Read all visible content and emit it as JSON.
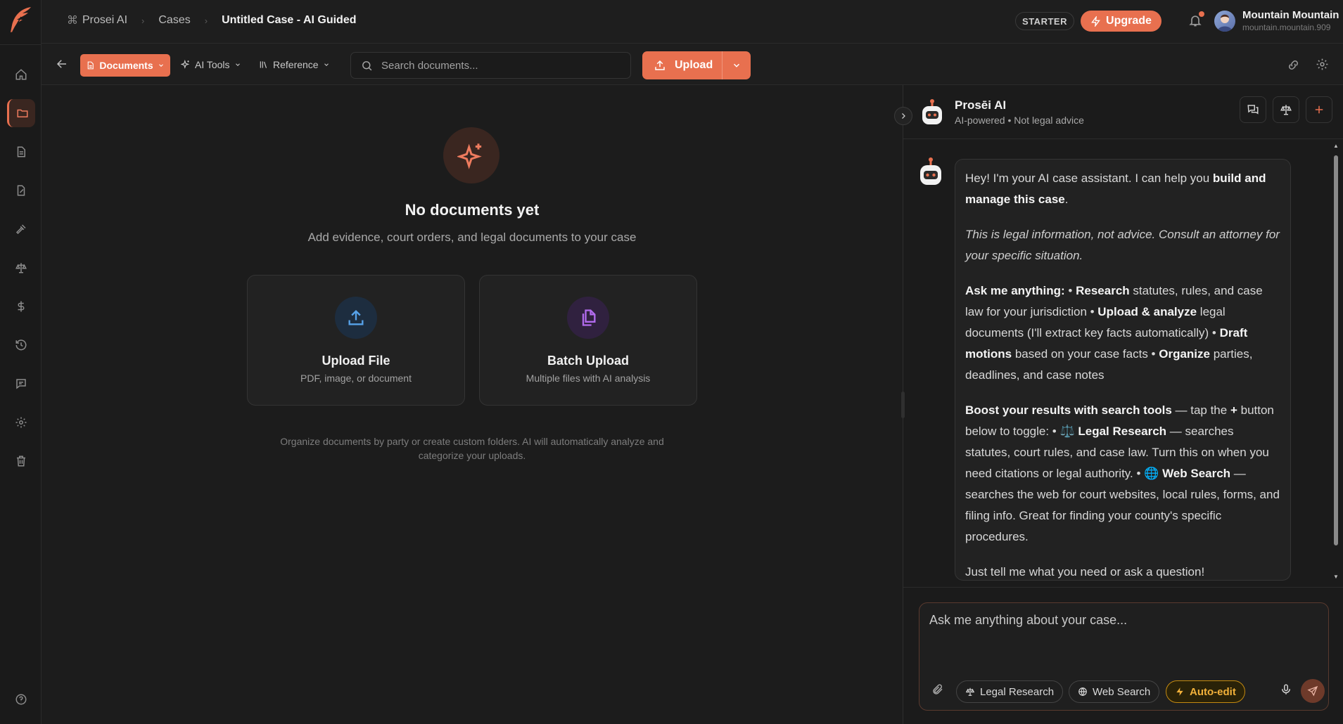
{
  "topbar": {
    "breadcrumbs": [
      "Prosei AI",
      "Cases",
      "Untitled Case - AI Guided"
    ],
    "plan_badge": "STARTER",
    "upgrade_label": "Upgrade",
    "user": {
      "name": "Mountain Mountain",
      "email": "mountain.mountain.909"
    }
  },
  "toolbar": {
    "documents_label": "Documents",
    "ai_tools_label": "AI Tools",
    "reference_label": "Reference",
    "search_placeholder": "Search documents...",
    "upload_label": "Upload"
  },
  "main": {
    "empty_title": "No documents yet",
    "empty_subtitle": "Add evidence, court orders, and legal documents to your case",
    "cards": [
      {
        "title": "Upload File",
        "subtitle": "PDF, image, or document"
      },
      {
        "title": "Batch Upload",
        "subtitle": "Multiple files with AI analysis"
      }
    ],
    "hint": "Organize documents by party or create custom folders. AI will automatically analyze and categorize your uploads."
  },
  "assistant": {
    "name": "Prosēi AI",
    "subtitle": "AI-powered • Not legal advice",
    "message": {
      "p1_a": "Hey! I'm your AI case assistant. I can help you ",
      "p1_b": "build and manage this case",
      "p1_c": ".",
      "p2": "This is legal information, not advice. Consult an attorney for your specific situation.",
      "p3": [
        {
          "b": "Ask me anything:",
          "t": " • "
        },
        {
          "b": "Research",
          "t": " statutes, rules, and case law for your jurisdiction • "
        },
        {
          "b": "Upload & analyze",
          "t": " legal documents (I'll extract key facts automatically) • "
        },
        {
          "b": "Draft motions",
          "t": " based on your case facts • "
        },
        {
          "b": "Organize",
          "t": " parties, deadlines, and case notes"
        }
      ],
      "p4": [
        {
          "b": "Boost your results with search tools",
          "t": " — tap the "
        },
        {
          "b": "+",
          "t": " button below to toggle: • ⚖️ "
        },
        {
          "b": "Legal Research",
          "t": " — searches statutes, court rules, and case law. Turn this on when you need citations or legal authority. • 🌐 "
        },
        {
          "b": "Web Search",
          "t": " — searches the web for court websites, local rules, forms, and filing info. Great for finding your county's specific procedures."
        }
      ],
      "p5": "Just tell me what you need or ask a question!"
    },
    "input_placeholder": "Ask me anything about your case...",
    "chips": {
      "legal_research": "Legal Research",
      "web_search": "Web Search",
      "auto_edit": "Auto-edit"
    }
  },
  "colors": {
    "accent": "#e8704f",
    "background": "#1c1c1c",
    "auto_edit": "#f2b13a"
  },
  "icons": {
    "rail": [
      "home-icon",
      "folder-icon",
      "document-icon",
      "edit-document-icon",
      "gavel-icon",
      "scales-icon",
      "dollar-icon",
      "history-icon",
      "message-icon",
      "settings-icon",
      "trash-icon",
      "help-icon"
    ]
  }
}
